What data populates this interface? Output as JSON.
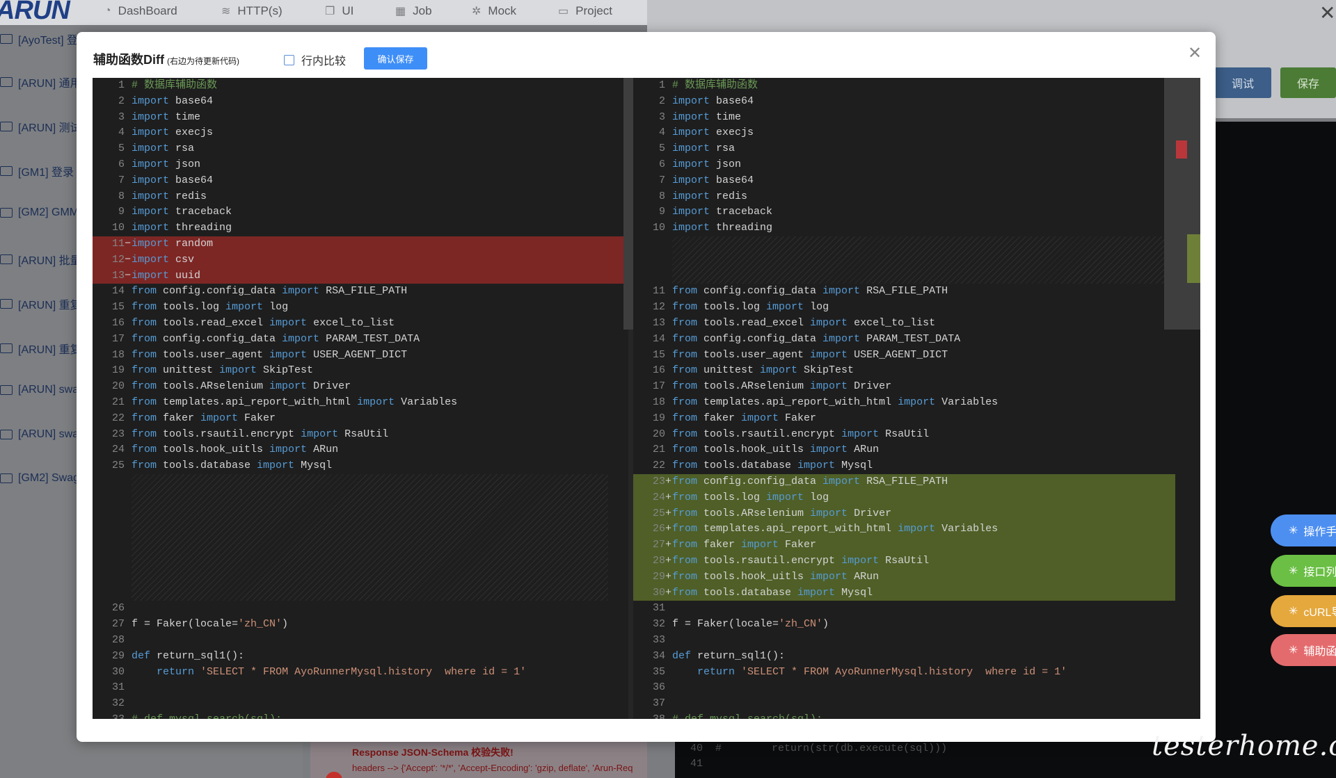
{
  "nav": {
    "logo": "ARUN",
    "items": [
      {
        "label": "DashBoard",
        "icon": "dashboard-icon"
      },
      {
        "label": "HTTP(s)",
        "icon": "http-icon"
      },
      {
        "label": "UI",
        "icon": "ui-icon"
      },
      {
        "label": "Job",
        "icon": "calendar-icon"
      },
      {
        "label": "Mock",
        "icon": "mock-icon"
      },
      {
        "label": "Project",
        "icon": "project-icon"
      }
    ],
    "close_glyph": "✕"
  },
  "sidebar": {
    "items": [
      {
        "label": "[AyoTest] 登"
      },
      {
        "label": "[ARUN] 通用"
      },
      {
        "label": "[ARUN] 测试"
      },
      {
        "label": "[GM1] 登录"
      },
      {
        "label": "[GM2] GMM"
      },
      {
        "label": "[ARUN] 批量"
      },
      {
        "label": "[ARUN] 重复"
      },
      {
        "label": "[ARUN] 重复"
      },
      {
        "label": "[ARUN] swa"
      },
      {
        "label": "[ARUN] swa"
      },
      {
        "label": "[GM2] Swag"
      }
    ]
  },
  "background": {
    "run_button": "调试",
    "save_button": "保存",
    "pills": [
      {
        "label": "操作手",
        "color": "#4d8ff1"
      },
      {
        "label": "接口列",
        "color": "#6abf44"
      },
      {
        "label": "cURL导",
        "color": "#e5a83d"
      },
      {
        "label": "辅助函",
        "color": "#e46b6d"
      }
    ],
    "error_title": "Response JSON-Schema 校验失败!",
    "error_sub": "headers --> {'Accept': '*/*', 'Accept-Encoding': 'gzip, deflate', 'Arun-Req",
    "code_lines": [
      {
        "n": "40",
        "text": "#        return(str(db.execute(sql)))"
      },
      {
        "n": "41",
        "text": ""
      }
    ],
    "watermark": "testerhome.com"
  },
  "modal": {
    "title": "辅助函数Diff",
    "subtitle": "(右边为待更新代码)",
    "inline_compare_label": "行内比较",
    "inline_compare_checked": false,
    "confirm_button": "确认保存",
    "close_glyph": "✕",
    "diff": {
      "left": [
        {
          "n": "1",
          "code": "# 数据库辅助函数",
          "type": "normal"
        },
        {
          "n": "2",
          "code": "import base64",
          "type": "normal"
        },
        {
          "n": "3",
          "code": "import time",
          "type": "normal"
        },
        {
          "n": "4",
          "code": "import execjs",
          "type": "normal"
        },
        {
          "n": "5",
          "code": "import rsa",
          "type": "normal"
        },
        {
          "n": "6",
          "code": "import json",
          "type": "normal"
        },
        {
          "n": "7",
          "code": "import base64",
          "type": "normal"
        },
        {
          "n": "8",
          "code": "import redis",
          "type": "normal"
        },
        {
          "n": "9",
          "code": "import traceback",
          "type": "normal"
        },
        {
          "n": "10",
          "code": "import threading",
          "type": "normal"
        },
        {
          "n": "11",
          "code": "import random",
          "type": "del"
        },
        {
          "n": "12",
          "code": "import csv",
          "type": "del"
        },
        {
          "n": "13",
          "code": "import uuid",
          "type": "del"
        },
        {
          "n": "14",
          "code": "from config.config_data import RSA_FILE_PATH",
          "type": "normal"
        },
        {
          "n": "15",
          "code": "from tools.log import log",
          "type": "normal"
        },
        {
          "n": "16",
          "code": "from tools.read_excel import excel_to_list",
          "type": "normal"
        },
        {
          "n": "17",
          "code": "from config.config_data import PARAM_TEST_DATA",
          "type": "normal"
        },
        {
          "n": "18",
          "code": "from tools.user_agent import USER_AGENT_DICT",
          "type": "normal"
        },
        {
          "n": "19",
          "code": "from unittest import SkipTest",
          "type": "normal"
        },
        {
          "n": "20",
          "code": "from tools.ARselenium import Driver",
          "type": "normal"
        },
        {
          "n": "21",
          "code": "from templates.api_report_with_html import Variables",
          "type": "normal"
        },
        {
          "n": "22",
          "code": "from faker import Faker",
          "type": "normal"
        },
        {
          "n": "23",
          "code": "from tools.rsautil.encrypt import RsaUtil",
          "type": "normal"
        },
        {
          "n": "24",
          "code": "from tools.hook_uitls import ARun",
          "type": "normal"
        },
        {
          "n": "25",
          "code": "from tools.database import Mysql",
          "type": "normal"
        },
        {
          "n": "",
          "code": "",
          "type": "pad",
          "rows": 8
        },
        {
          "n": "26",
          "code": "",
          "type": "normal"
        },
        {
          "n": "27",
          "code": "f = Faker(locale='zh_CN')",
          "type": "normal"
        },
        {
          "n": "28",
          "code": "",
          "type": "normal"
        },
        {
          "n": "29",
          "code": "def return_sql1():",
          "type": "normal"
        },
        {
          "n": "30",
          "code": "    return 'SELECT * FROM AyoRunnerMysql.history  where id = 1'",
          "type": "normal"
        },
        {
          "n": "31",
          "code": "",
          "type": "normal"
        },
        {
          "n": "32",
          "code": "",
          "type": "normal"
        },
        {
          "n": "33",
          "code": "# def mysql_search(sql):",
          "type": "normal"
        }
      ],
      "right": [
        {
          "n": "1",
          "code": "# 数据库辅助函数",
          "type": "normal"
        },
        {
          "n": "2",
          "code": "import base64",
          "type": "normal"
        },
        {
          "n": "3",
          "code": "import time",
          "type": "normal"
        },
        {
          "n": "4",
          "code": "import execjs",
          "type": "normal"
        },
        {
          "n": "5",
          "code": "import rsa",
          "type": "normal"
        },
        {
          "n": "6",
          "code": "import json",
          "type": "normal"
        },
        {
          "n": "7",
          "code": "import base64",
          "type": "normal"
        },
        {
          "n": "8",
          "code": "import redis",
          "type": "normal"
        },
        {
          "n": "9",
          "code": "import traceback",
          "type": "normal"
        },
        {
          "n": "10",
          "code": "import threading",
          "type": "normal"
        },
        {
          "n": "",
          "code": "",
          "type": "pad",
          "rows": 3
        },
        {
          "n": "11",
          "code": "from config.config_data import RSA_FILE_PATH",
          "type": "normal"
        },
        {
          "n": "12",
          "code": "from tools.log import log",
          "type": "normal"
        },
        {
          "n": "13",
          "code": "from tools.read_excel import excel_to_list",
          "type": "normal"
        },
        {
          "n": "14",
          "code": "from config.config_data import PARAM_TEST_DATA",
          "type": "normal"
        },
        {
          "n": "15",
          "code": "from tools.user_agent import USER_AGENT_DICT",
          "type": "normal"
        },
        {
          "n": "16",
          "code": "from unittest import SkipTest",
          "type": "normal"
        },
        {
          "n": "17",
          "code": "from tools.ARselenium import Driver",
          "type": "normal"
        },
        {
          "n": "18",
          "code": "from templates.api_report_with_html import Variables",
          "type": "normal"
        },
        {
          "n": "19",
          "code": "from faker import Faker",
          "type": "normal"
        },
        {
          "n": "20",
          "code": "from tools.rsautil.encrypt import RsaUtil",
          "type": "normal"
        },
        {
          "n": "21",
          "code": "from tools.hook_uitls import ARun",
          "type": "normal"
        },
        {
          "n": "22",
          "code": "from tools.database import Mysql",
          "type": "normal"
        },
        {
          "n": "23",
          "code": "from config.config_data import RSA_FILE_PATH",
          "type": "ins"
        },
        {
          "n": "24",
          "code": "from tools.log import log",
          "type": "ins"
        },
        {
          "n": "25",
          "code": "from tools.ARselenium import Driver",
          "type": "ins"
        },
        {
          "n": "26",
          "code": "from templates.api_report_with_html import Variables",
          "type": "ins"
        },
        {
          "n": "27",
          "code": "from faker import Faker",
          "type": "ins"
        },
        {
          "n": "28",
          "code": "from tools.rsautil.encrypt import RsaUtil",
          "type": "ins"
        },
        {
          "n": "29",
          "code": "from tools.hook_uitls import ARun",
          "type": "ins"
        },
        {
          "n": "30",
          "code": "from tools.database import Mysql",
          "type": "ins"
        },
        {
          "n": "31",
          "code": "",
          "type": "normal"
        },
        {
          "n": "32",
          "code": "f = Faker(locale='zh_CN')",
          "type": "normal"
        },
        {
          "n": "33",
          "code": "",
          "type": "normal"
        },
        {
          "n": "34",
          "code": "def return_sql1():",
          "type": "normal"
        },
        {
          "n": "35",
          "code": "    return 'SELECT * FROM AyoRunnerMysql.history  where id = 1'",
          "type": "normal"
        },
        {
          "n": "36",
          "code": "",
          "type": "normal"
        },
        {
          "n": "37",
          "code": "",
          "type": "normal"
        },
        {
          "n": "38",
          "code": "# def mysql_search(sql):",
          "type": "normal"
        }
      ]
    }
  }
}
